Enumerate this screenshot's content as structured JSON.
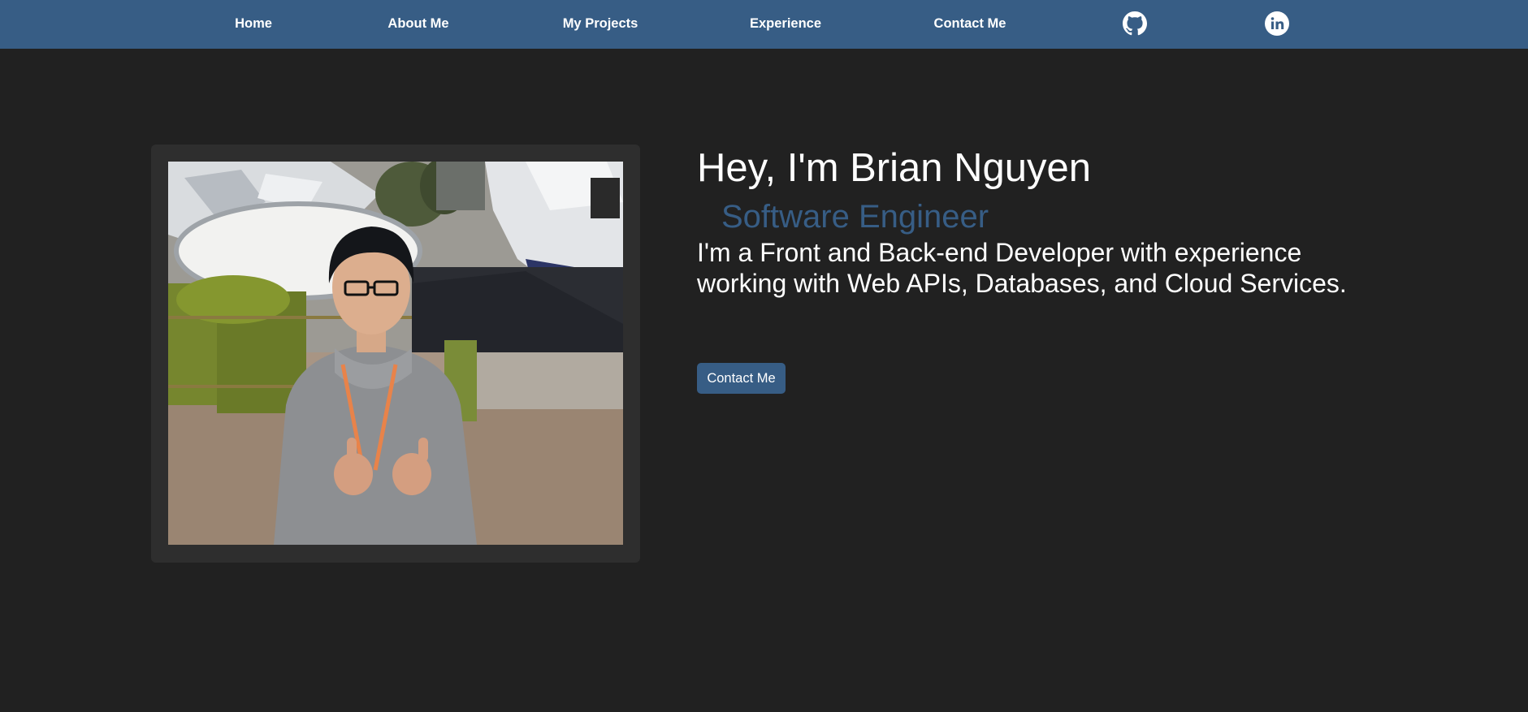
{
  "nav": {
    "links": [
      {
        "label": "Home"
      },
      {
        "label": "About Me"
      },
      {
        "label": "My Projects"
      },
      {
        "label": "Experience"
      },
      {
        "label": "Contact Me"
      }
    ],
    "icons": [
      "github-icon",
      "linkedin-icon"
    ]
  },
  "hero": {
    "greeting": "Hey, I'm Brian Nguyen",
    "role": "Software Engineer",
    "bio": "I'm a Front and Back-end Developer with experience working with Web APIs, Databases, and Cloud Services.",
    "button_label": "Contact Me"
  },
  "colors": {
    "navbar": "#375d85",
    "background": "#212121",
    "photo_frame": "#2e2e2e",
    "accent_text": "#375d85",
    "text": "#ffffff"
  }
}
